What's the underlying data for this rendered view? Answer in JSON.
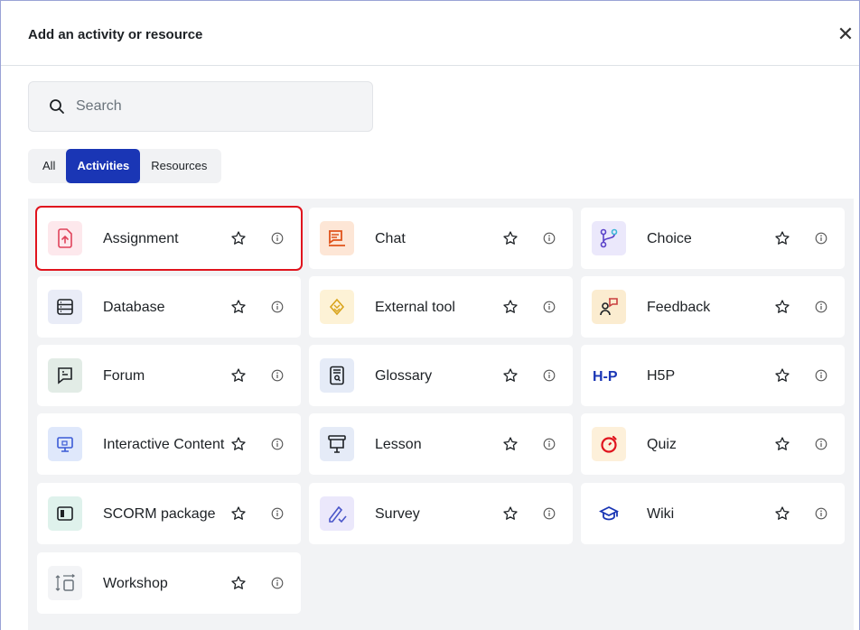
{
  "dialog": {
    "title": "Add an activity or resource",
    "close_symbol": "✕"
  },
  "search": {
    "placeholder": "Search",
    "value": ""
  },
  "tabs": [
    {
      "label": "All",
      "active": false
    },
    {
      "label": "Activities",
      "active": true
    },
    {
      "label": "Resources",
      "active": false
    }
  ],
  "colors": {
    "active_tab": "#1a36b5",
    "highlight_border": "#e0141e"
  },
  "activities": [
    {
      "label": "Assignment",
      "icon": "assignment-icon",
      "color": "#e0435b",
      "bg": "#fde8ec",
      "highlighted": true
    },
    {
      "label": "Chat",
      "icon": "chat-icon",
      "color": "#e0531b",
      "bg": "#fde6d6",
      "highlighted": false
    },
    {
      "label": "Choice",
      "icon": "choice-icon",
      "color": "#5a42c9",
      "bg": "#ebe8fb",
      "highlighted": false
    },
    {
      "label": "Database",
      "icon": "database-icon",
      "color": "#1d2125",
      "bg": "#e9ecf7",
      "highlighted": false
    },
    {
      "label": "External tool",
      "icon": "external-tool-icon",
      "color": "#d9a41c",
      "bg": "#fdf2d6",
      "highlighted": false
    },
    {
      "label": "Feedback",
      "icon": "feedback-icon",
      "color": "#c93f3f",
      "bg": "#fbecd0",
      "highlighted": false
    },
    {
      "label": "Forum",
      "icon": "forum-icon",
      "color": "#1d2125",
      "bg": "#e2ece6",
      "highlighted": false
    },
    {
      "label": "Glossary",
      "icon": "glossary-icon",
      "color": "#1d2125",
      "bg": "#e5ebf7",
      "highlighted": false
    },
    {
      "label": "H5P",
      "icon": "h5p-icon",
      "color": "#1a36b5",
      "bg": "#ffffff",
      "highlighted": false
    },
    {
      "label": "Interactive Content",
      "icon": "interactive-content-icon",
      "color": "#3b5bd6",
      "bg": "#dfe8fb",
      "highlighted": false
    },
    {
      "label": "Lesson",
      "icon": "lesson-icon",
      "color": "#1d2125",
      "bg": "#e5ebf7",
      "highlighted": false
    },
    {
      "label": "Quiz",
      "icon": "quiz-icon",
      "color": "#e0141e",
      "bg": "#fdf0da",
      "highlighted": false
    },
    {
      "label": "SCORM package",
      "icon": "scorm-package-icon",
      "color": "#1d2125",
      "bg": "#dff2ec",
      "highlighted": false
    },
    {
      "label": "Survey",
      "icon": "survey-icon",
      "color": "#4a56c9",
      "bg": "#ebe8fb",
      "highlighted": false
    },
    {
      "label": "Wiki",
      "icon": "wiki-icon",
      "color": "#1a36b5",
      "bg": "#ffffff",
      "highlighted": false
    },
    {
      "label": "Workshop",
      "icon": "workshop-icon",
      "color": "#6a737b",
      "bg": "#f3f4f6",
      "highlighted": false
    }
  ]
}
